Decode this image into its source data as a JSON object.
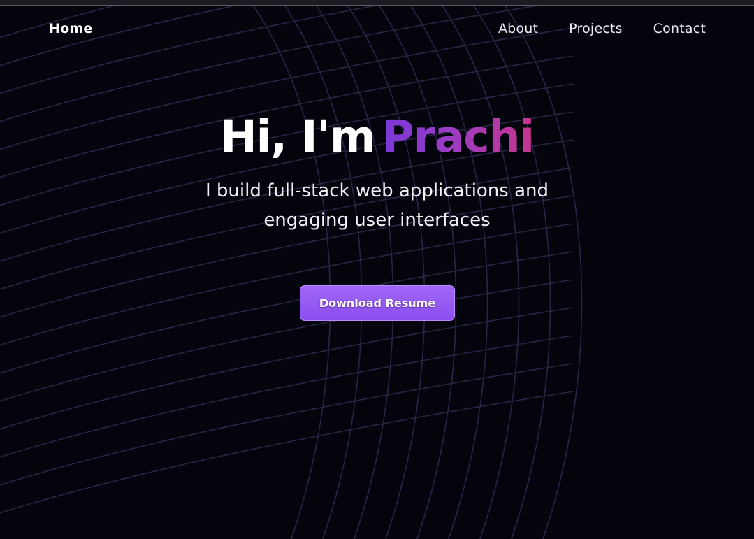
{
  "nav": {
    "home_label": "Home",
    "links": [
      "About",
      "Projects",
      "Contact"
    ]
  },
  "hero": {
    "greeting": "Hi, I'm",
    "name": "Prachi",
    "subtitle": "I build full-stack web applications and engaging user interfaces",
    "cta_label": "Download Resume"
  },
  "colors": {
    "background": "#04040d",
    "name_gradient_start": "#7a38d8",
    "name_gradient_end": "#c9348e",
    "button": "#9a5ff5",
    "grid_lines": "#2e2c4e"
  }
}
